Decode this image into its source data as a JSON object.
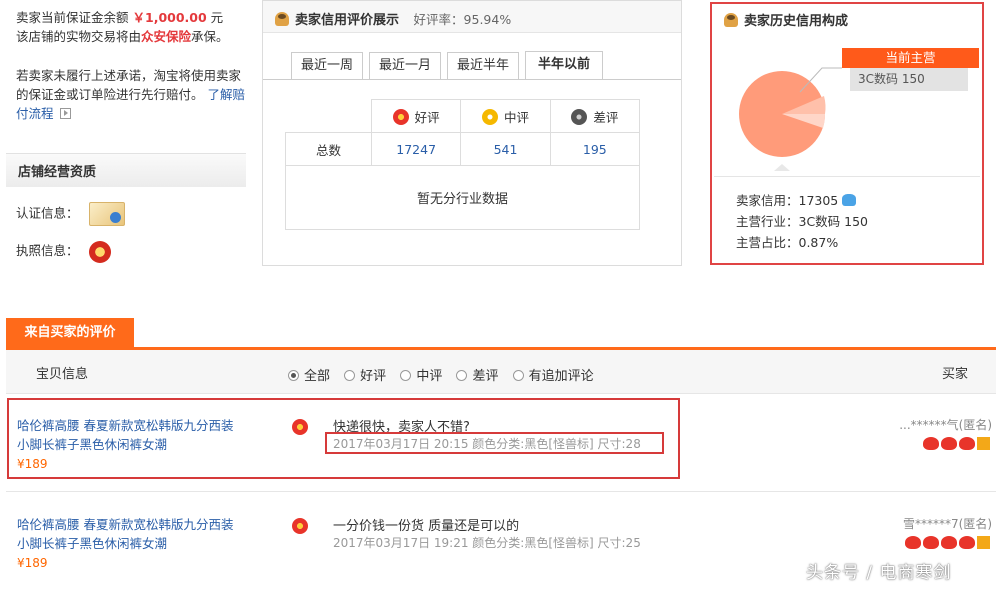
{
  "left": {
    "guarantee_prefix": "卖家当前保证金余额",
    "guarantee_amount": "￥1,000.00",
    "guarantee_unit": "元",
    "insurance_prefix": "该店铺的实物交易将由",
    "insurance_name": "众安保险",
    "insurance_suffix": "承保。",
    "promise_text": "若卖家未履行上述承诺，淘宝将使用卖家的保证金或订单险进行先行赔付。",
    "promise_link": "了解赔付流程",
    "qual_title": "店铺经营资质",
    "cert_label": "认证信息：",
    "license_label": "执照信息："
  },
  "credit": {
    "title": "卖家信用评价展示",
    "rate": "好评率：95.94%",
    "tabs": [
      "最近一周",
      "最近一月",
      "最近半年",
      "半年以前"
    ],
    "headers": [
      "好评",
      "中评",
      "差评"
    ],
    "row_label": "总数",
    "good": "17247",
    "mid": "541",
    "bad": "195",
    "nodata": "暂无分行业数据"
  },
  "history": {
    "title": "卖家历史信用构成",
    "main_tag": "当前主营",
    "category": "3C数码   150",
    "credit_line": "卖家信用：17305",
    "industry_line": "主营行业：3C数码 150",
    "share_line": "主营占比：0.87%",
    "pie_color": "#ff9b7a"
  },
  "reviews": {
    "tab_label": "来自买家的评价",
    "col_item": "宝贝信息",
    "col_buyer": "买家",
    "filters": [
      "全部",
      "好评",
      "中评",
      "差评",
      "有追加评论"
    ],
    "items": [
      {
        "product": "哈伦裤高腰 春夏新款宽松韩版九分西装小脚长裤子黑色休闲裤女潮",
        "price": "¥189",
        "text": "快递很快，卖家人不错?",
        "meta": "2017年03月17日 20:15  颜色分类:黑色[怪兽标]   尺寸:28",
        "buyer": "...******气(匿名)"
      },
      {
        "product": "哈伦裤高腰 春夏新款宽松韩版九分西装小脚长裤子黑色休闲裤女潮",
        "price": "¥189",
        "text": "一分价钱一份货 质量还是可以的",
        "meta": "2017年03月17日 19:21  颜色分类:黑色[怪兽标]   尺寸:25",
        "buyer": "雪******7(匿名)"
      }
    ]
  },
  "watermark": "头条号 / 电商寒剑"
}
